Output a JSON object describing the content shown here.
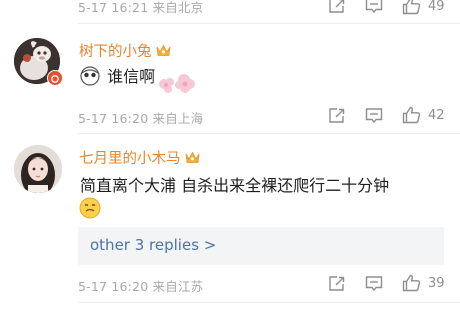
{
  "top_row": {
    "meta": "5-17 16:21 来自北京",
    "like_count": "49"
  },
  "comments": [
    {
      "username": "树下的小兔",
      "text": "谁信啊",
      "meta": "5-17 16:20 来自上海",
      "like_count": "42",
      "badge_icon": "crown-icon"
    },
    {
      "username": "七月里的小木马",
      "text": "简直离个大浦 自杀出来全裸还爬行二十分钟",
      "meta": "5-17 16:20 来自江苏",
      "like_count": "39",
      "badge_icon": "crown-icon",
      "replies_link": "other 3 replies >"
    }
  ],
  "colors": {
    "username": "#e8862c",
    "link": "#4d74a6",
    "meta": "#a9a9a9"
  },
  "icons": [
    "share-icon",
    "comment-icon",
    "like-icon",
    "crown-icon",
    "emoji-icon"
  ]
}
